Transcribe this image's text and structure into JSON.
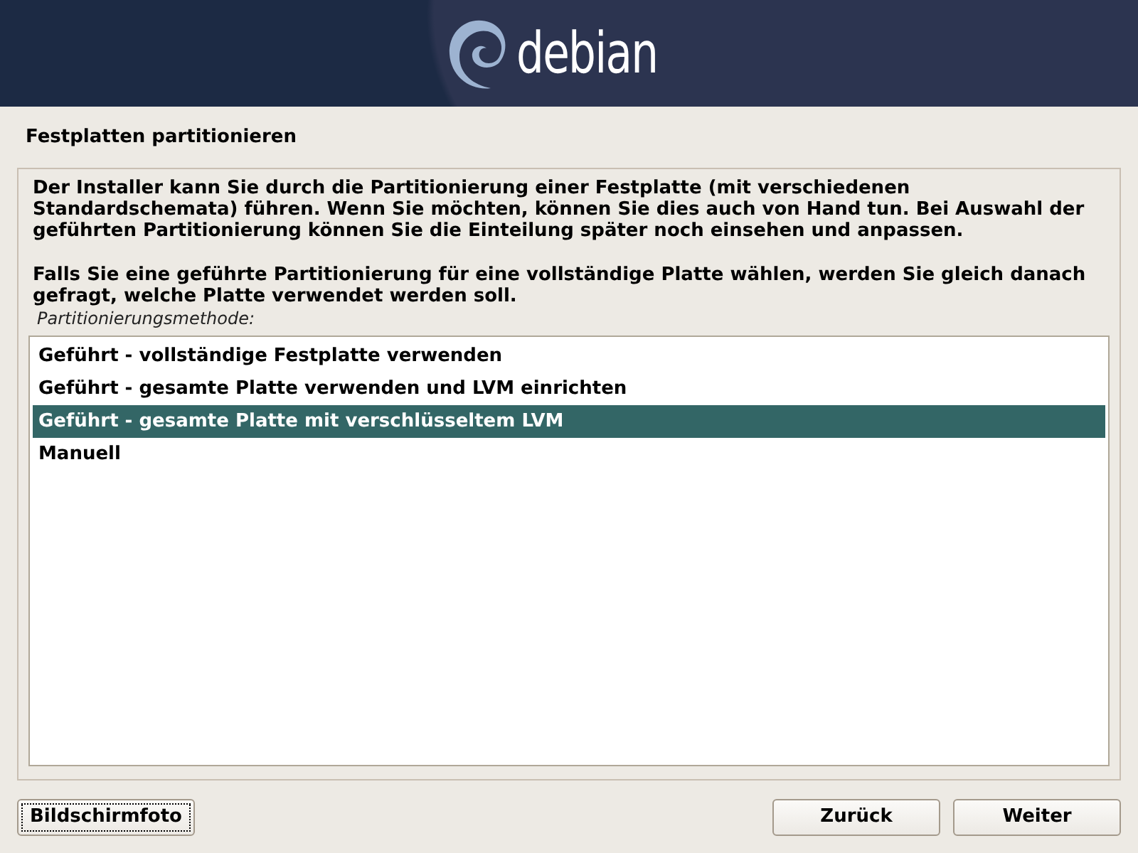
{
  "header": {
    "logo_text": "debian"
  },
  "title": "Festplatten partitionieren",
  "paragraphs": [
    "Der Installer kann Sie durch die Partitionierung einer Festplatte (mit verschiedenen Standardschemata) führen. Wenn Sie möchten, können Sie dies auch von Hand tun. Bei Auswahl der geführten Partitionierung können Sie die Einteilung später noch einsehen und anpassen.",
    "Falls Sie eine geführte Partitionierung für eine vollständige Platte wählen, werden Sie gleich danach gefragt, welche Platte verwendet werden soll."
  ],
  "list_label": "Partitionierungsmethode:",
  "options": [
    {
      "label": "Geführt - vollständige Festplatte verwenden",
      "selected": false
    },
    {
      "label": "Geführt - gesamte Platte verwenden und LVM einrichten",
      "selected": false
    },
    {
      "label": "Geführt - gesamte Platte mit verschlüsseltem LVM",
      "selected": true
    },
    {
      "label": "Manuell",
      "selected": false
    }
  ],
  "screenshot_button": {
    "label": "Bildschirmfoto",
    "focused": true
  },
  "nav_buttons": [
    {
      "label": "Zurück",
      "focused": false
    },
    {
      "label": "Weiter",
      "focused": false
    }
  ]
}
